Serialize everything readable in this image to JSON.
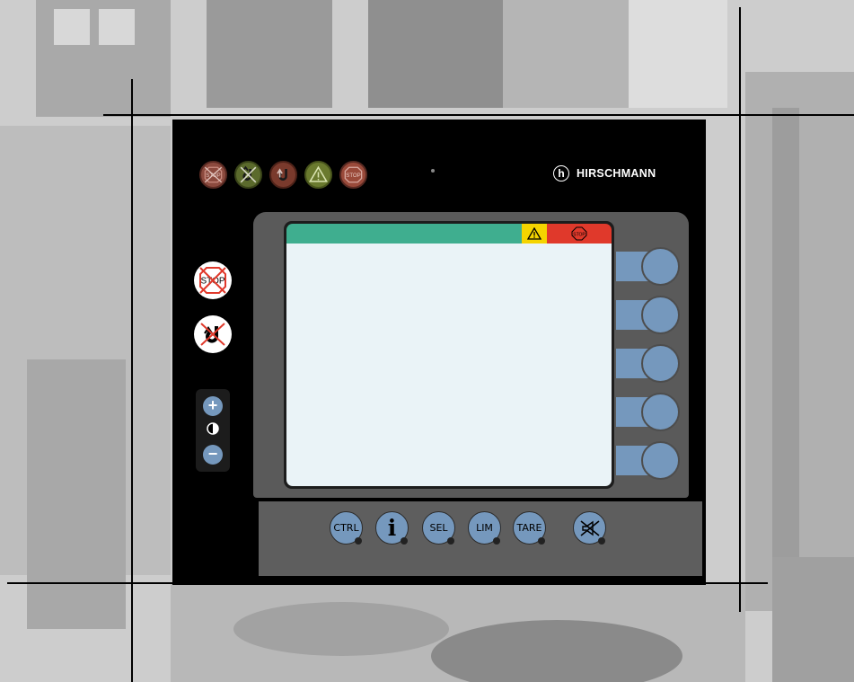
{
  "colors": {
    "panel": "#000000",
    "bezel": "#5a5a5a",
    "status_green": "#3fae8f",
    "status_warning": "#f5d400",
    "status_stop": "#e0392b",
    "display": "#eaf3f7",
    "button_blue": "#7598bd"
  },
  "header": {
    "indicators": [
      {
        "name": "stop-indicator",
        "icon": "crossed-stop-sign-icon",
        "label": "STOP"
      },
      {
        "name": "hoist-cutoff-indicator",
        "icon": "crossed-hoist-hook-icon"
      },
      {
        "name": "hoist-indicator",
        "icon": "hoist-hook-icon"
      },
      {
        "name": "warning-indicator",
        "icon": "warning-triangle-icon"
      },
      {
        "name": "stop-lamp-indicator",
        "icon": "stop-sign-icon",
        "label": "STOP"
      }
    ],
    "brand": {
      "logo_letter": "h",
      "name": "HIRSCHMANN"
    }
  },
  "left_controls": {
    "stop_override": {
      "icon": "crossed-stop-sign-icon",
      "label": "STOP"
    },
    "hoist_override": {
      "icon": "crossed-hoist-hook-icon"
    },
    "contrast": {
      "plus": "+",
      "minus": "−",
      "icon": "contrast-icon"
    }
  },
  "screen": {
    "status_bar": {
      "warning_icon": "warning-triangle-icon",
      "stop_label": "STOP"
    },
    "softkeys": 5
  },
  "function_keys": [
    {
      "name": "ctrl-button",
      "label": "CTRL"
    },
    {
      "name": "info-button",
      "label": "i",
      "icon": "info-icon"
    },
    {
      "name": "sel-button",
      "label": "SEL"
    },
    {
      "name": "lim-button",
      "label": "LIM"
    },
    {
      "name": "tare-button",
      "label": "TARE"
    },
    {
      "name": "alarm-mute-button",
      "icon": "muted-horn-icon"
    }
  ]
}
